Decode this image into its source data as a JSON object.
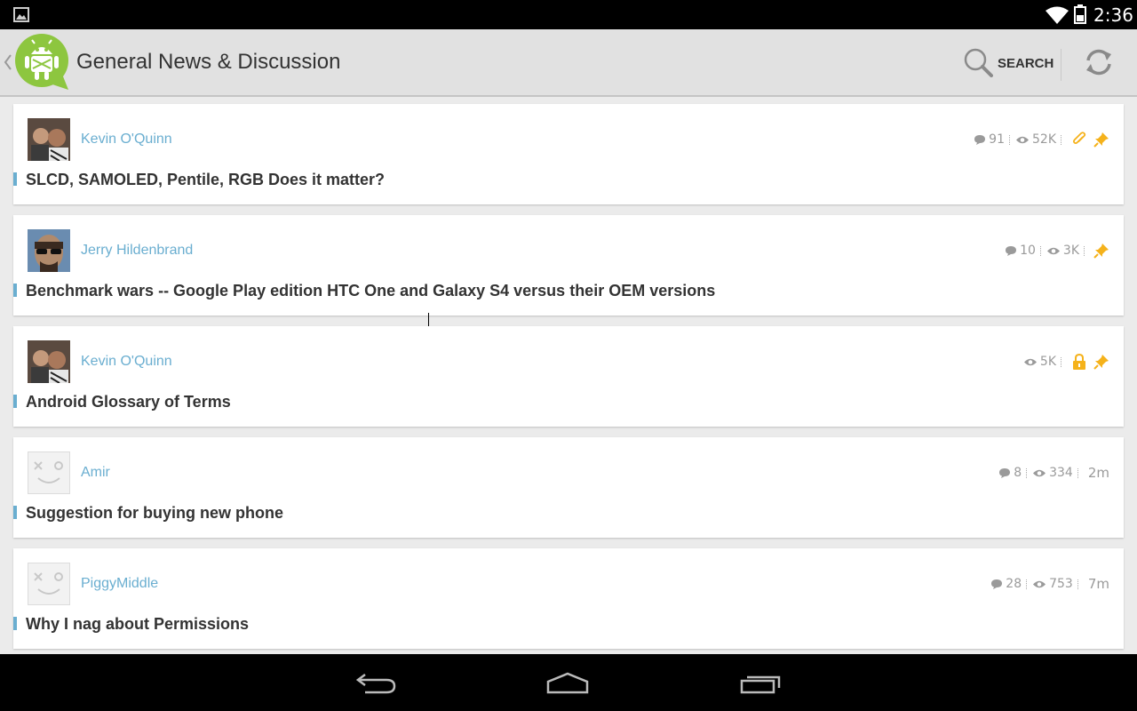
{
  "status_bar": {
    "time": "2:36",
    "icons": [
      "image-icon",
      "wifi-icon",
      "battery-icon"
    ]
  },
  "action_bar": {
    "title": "General News & Discussion",
    "search_label": "SEARCH",
    "icons": [
      "up-caret-icon",
      "android-logo-icon",
      "search-icon",
      "refresh-icon"
    ]
  },
  "colors": {
    "accent": "#6aaed0",
    "flag": "#f5b21b",
    "action_bar": "#e1e1e1"
  },
  "threads": [
    {
      "author": "Kevin O'Quinn",
      "title": "SLCD, SAMOLED, Pentile, RGB Does it matter?",
      "replies": "91",
      "views": "52K",
      "flags": [
        "attachment-icon",
        "pin-icon"
      ],
      "time": ""
    },
    {
      "author": "Jerry Hildenbrand",
      "title": "Benchmark wars -- Google Play edition HTC One and Galaxy S4 versus their OEM versions",
      "replies": "10",
      "views": "3K",
      "flags": [
        "pin-icon"
      ],
      "time": ""
    },
    {
      "author": "Kevin O'Quinn",
      "title": "Android Glossary of Terms",
      "replies": "",
      "views": "5K",
      "flags": [
        "lock-icon",
        "pin-icon"
      ],
      "time": ""
    },
    {
      "author": "Amir",
      "title": "Suggestion for buying new phone",
      "replies": "8",
      "views": "334",
      "flags": [],
      "time": "2m"
    },
    {
      "author": "PiggyMiddle",
      "title": "Why I nag about Permissions",
      "replies": "28",
      "views": "753",
      "flags": [],
      "time": "7m"
    }
  ],
  "nav_bar": {
    "icons": [
      "back-icon",
      "home-icon",
      "recents-icon"
    ]
  }
}
